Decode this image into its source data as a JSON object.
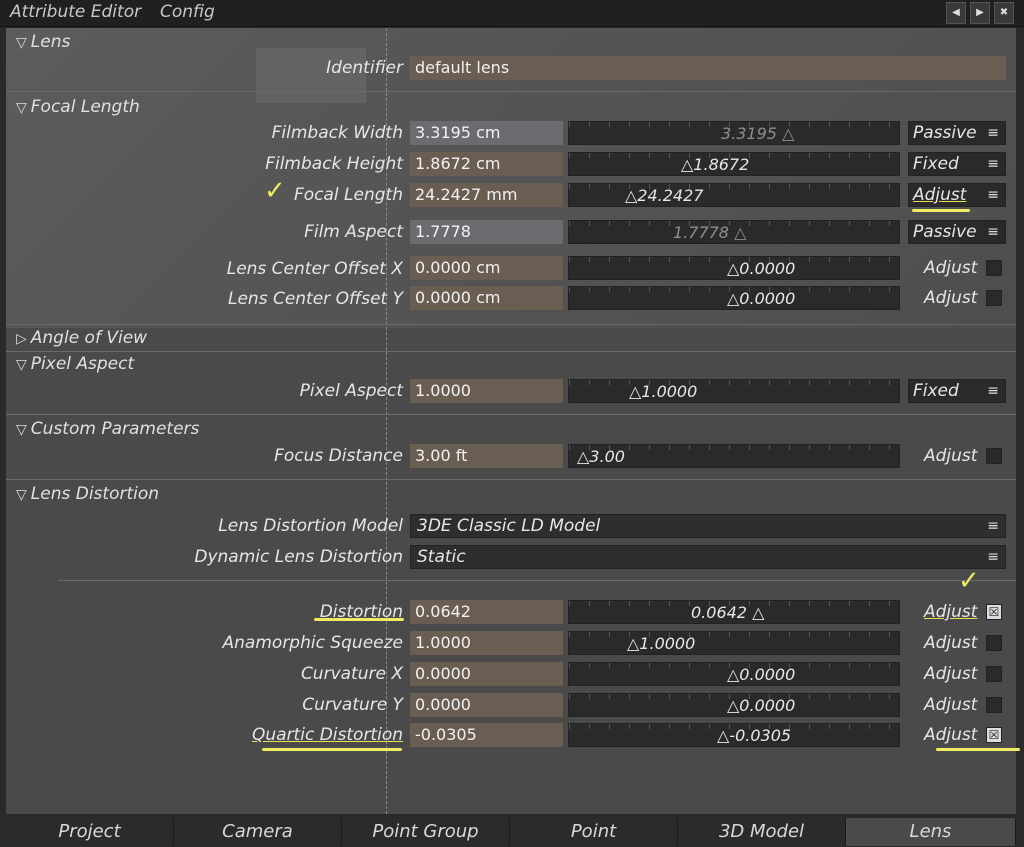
{
  "menubar": {
    "items": [
      "Attribute Editor",
      "Config"
    ]
  },
  "sections": {
    "lens": "Lens",
    "focal_length": "Focal Length",
    "angle_of_view": "Angle of View",
    "pixel_aspect": "Pixel Aspect",
    "custom_parameters": "Custom Parameters",
    "lens_distortion": "Lens Distortion"
  },
  "identifier": {
    "label": "Identifier",
    "value": "default lens"
  },
  "rows": {
    "filmback_width": {
      "label": "Filmback Width",
      "value": "3.3195 cm",
      "slider": "3.3195 △",
      "mode": "Passive"
    },
    "filmback_height": {
      "label": "Filmback Height",
      "value": "1.8672 cm",
      "slider": "△1.8672",
      "mode": "Fixed"
    },
    "focal_length": {
      "label": "Focal Length",
      "value": "24.2427 mm",
      "slider": "△24.2427",
      "mode": "Adjust"
    },
    "film_aspect": {
      "label": "Film Aspect",
      "value": "1.7778",
      "slider": "1.7778 △",
      "mode": "Passive"
    },
    "lens_center_x": {
      "label": "Lens Center Offset X",
      "value": "0.0000 cm",
      "slider": "△0.0000",
      "adjust": "Adjust"
    },
    "lens_center_y": {
      "label": "Lens Center Offset Y",
      "value": "0.0000 cm",
      "slider": "△0.0000",
      "adjust": "Adjust"
    },
    "pixel_aspect": {
      "label": "Pixel Aspect",
      "value": "1.0000",
      "slider": "△1.0000",
      "mode": "Fixed"
    },
    "focus_distance": {
      "label": "Focus Distance",
      "value": "3.00 ft",
      "slider": "△3.00",
      "adjust": "Adjust"
    },
    "ld_model": {
      "label": "Lens Distortion Model",
      "value": "3DE Classic LD Model"
    },
    "dynamic_ld": {
      "label": "Dynamic Lens Distortion",
      "value": "Static"
    },
    "distortion": {
      "label": "Distortion",
      "value": "0.0642",
      "slider": "0.0642 △",
      "adjust": "Adjust",
      "checked": true
    },
    "anamorphic": {
      "label": "Anamorphic Squeeze",
      "value": "1.0000",
      "slider": "△1.0000",
      "adjust": "Adjust"
    },
    "curvature_x": {
      "label": "Curvature X",
      "value": "0.0000",
      "slider": "△0.0000",
      "adjust": "Adjust"
    },
    "curvature_y": {
      "label": "Curvature Y",
      "value": "0.0000",
      "slider": "△0.0000",
      "adjust": "Adjust"
    },
    "quartic": {
      "label": "Quartic Distortion",
      "value": "-0.0305",
      "slider": "△-0.0305",
      "adjust": "Adjust",
      "checked": true
    }
  },
  "icons": {
    "checked": "☒",
    "menu": "≡",
    "expanded": "▽",
    "collapsed": "▷"
  },
  "tabs": [
    "Project",
    "Camera",
    "Point Group",
    "Point",
    "3D Model",
    "Lens"
  ],
  "active_tab": "Lens"
}
